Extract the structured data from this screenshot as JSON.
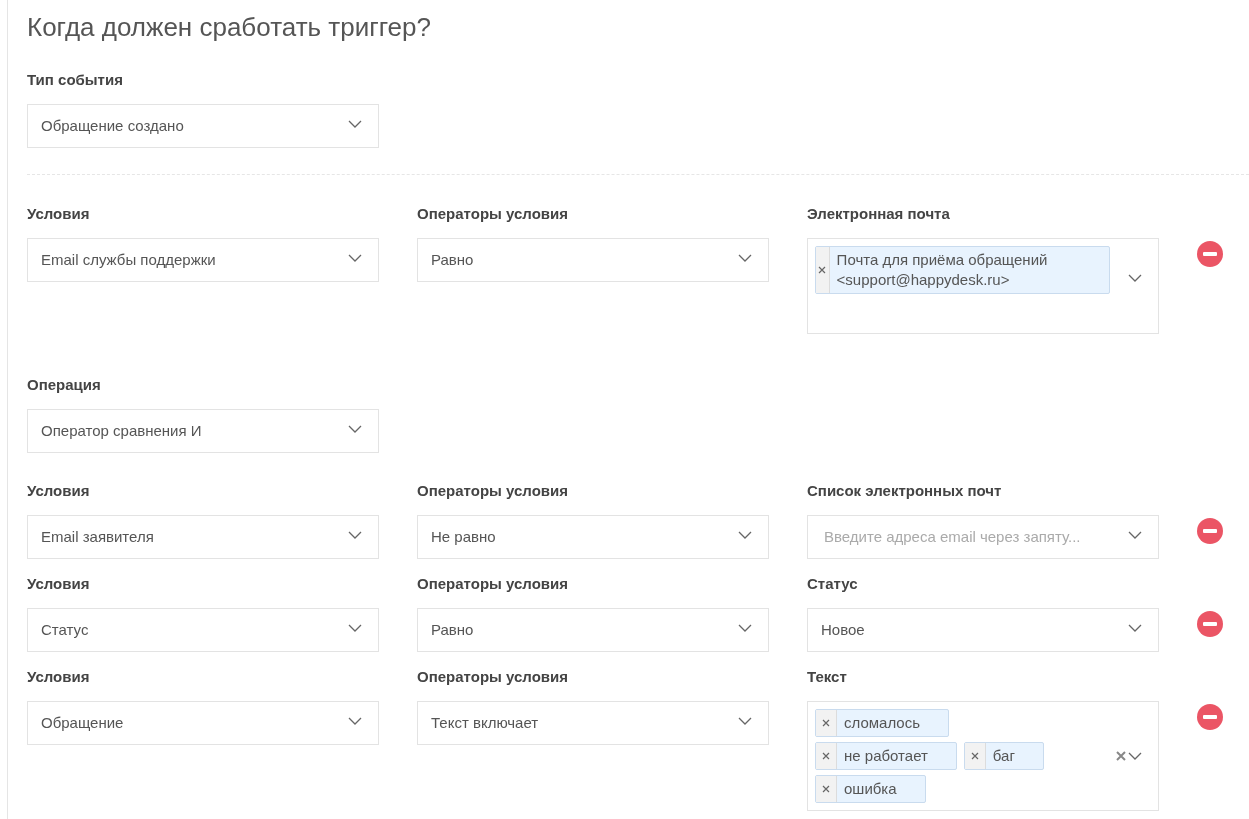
{
  "title": "Когда должен сработать триггер?",
  "event_type": {
    "label": "Тип события",
    "value": "Обращение создано"
  },
  "first_conditions": [
    {
      "condition": {
        "label": "Условия",
        "value": "Email службы поддержки"
      },
      "operator": {
        "label": "Операторы условия",
        "value": "Равно"
      },
      "target": {
        "label": "Электронная почта",
        "kind": "tags",
        "tall": true,
        "clear_button": false,
        "tags": [
          "Почта для приёма обращений <support@happydesk.ru>"
        ]
      }
    }
  ],
  "operation": {
    "label": "Операция",
    "value": "Оператор сравнения И"
  },
  "conditions": [
    {
      "condition": {
        "label": "Условия",
        "value": "Email заявителя"
      },
      "operator": {
        "label": "Операторы условия",
        "value": "Не равно"
      },
      "target": {
        "label": "Список электронных почт",
        "kind": "input",
        "placeholder": "Введите адреса email через запяту..."
      }
    },
    {
      "condition": {
        "label": "Условия",
        "value": "Статус"
      },
      "operator": {
        "label": "Операторы условия",
        "value": "Равно"
      },
      "target": {
        "label": "Статус",
        "kind": "select",
        "value": "Новое"
      }
    },
    {
      "condition": {
        "label": "Условия",
        "value": "Обращение"
      },
      "operator": {
        "label": "Операторы условия",
        "value": "Текст включает"
      },
      "target": {
        "label": "Текст",
        "kind": "tags",
        "tall": false,
        "clear_button": true,
        "tags": [
          "сломалось",
          "не работает",
          "баг",
          "ошибка"
        ]
      }
    }
  ]
}
